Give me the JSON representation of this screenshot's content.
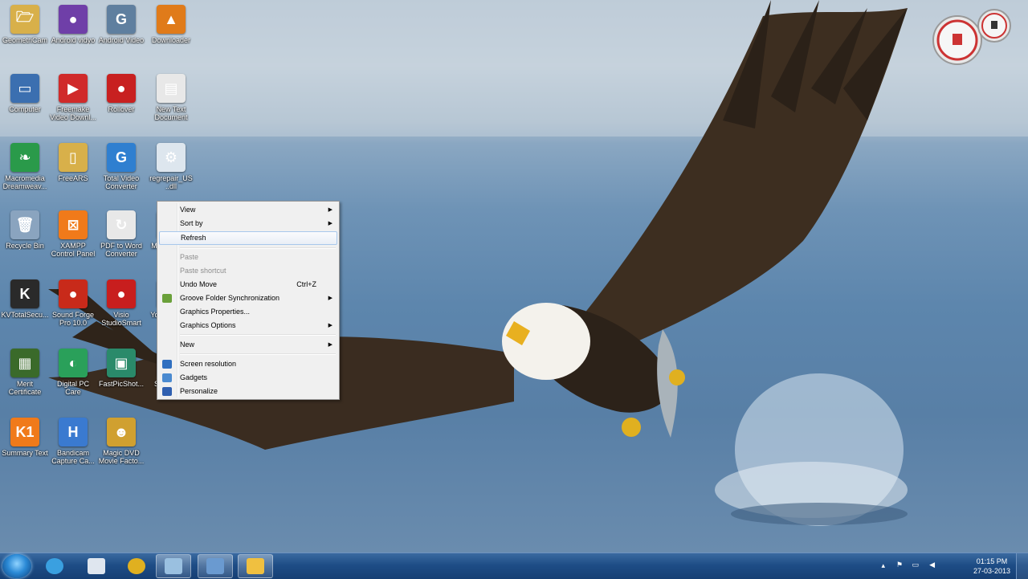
{
  "desktop": {
    "icons": [
      {
        "label": "GeometriCam",
        "color": "#d8b04a",
        "symbol": "🗁"
      },
      {
        "label": "Android vidyo",
        "color": "#6f3fa8",
        "symbol": "●"
      },
      {
        "label": "Android Video",
        "color": "#5f7f9f",
        "symbol": "G"
      },
      {
        "label": "Downloader",
        "color": "#e07b1a",
        "symbol": "▲"
      },
      {
        "label": "Computer",
        "color": "#3b6fb0",
        "symbol": "▭"
      },
      {
        "label": "Freemake Video Downl...",
        "color": "#d02a2a",
        "symbol": "▶"
      },
      {
        "label": "Rollover",
        "color": "#c82020",
        "symbol": "●"
      },
      {
        "label": "New Text Document",
        "color": "#e8e8e8",
        "symbol": "▤"
      },
      {
        "label": "Macromedia Dreamweav...",
        "color": "#2a9a4a",
        "symbol": "❧"
      },
      {
        "label": "FreeARS",
        "color": "#d8b04a",
        "symbol": "▯"
      },
      {
        "label": "Total Video Converter",
        "color": "#2f7fd0",
        "symbol": "G"
      },
      {
        "label": "regrepair_US ..dll",
        "color": "#dde6ee",
        "symbol": "⚙"
      },
      {
        "label": "Recycle Bin",
        "color": "#8aa4bf",
        "symbol": "🗑"
      },
      {
        "label": "XAMPP Control Panel",
        "color": "#f07a1a",
        "symbol": "⊠"
      },
      {
        "label": "PDF to Word Converter",
        "color": "#e8e8e8",
        "symbol": "↻"
      },
      {
        "label": "Macromedia Flash 8",
        "color": "#c81e1e",
        "symbol": "f"
      },
      {
        "label": "KVTotalSecu...",
        "color": "#2a2a2a",
        "symbol": "K"
      },
      {
        "label": "Sound Forge Pro 10.0",
        "color": "#c82a1a",
        "symbol": "●"
      },
      {
        "label": "Visio StudioSmart",
        "color": "#c81e1e",
        "symbol": "●"
      },
      {
        "label": "YouTube S...",
        "color": "#8a1a1a",
        "symbol": "◯"
      },
      {
        "label": "Merit Certificate",
        "color": "#3a6a2a",
        "symbol": "▦"
      },
      {
        "label": "Digital PC Care",
        "color": "#2aa05a",
        "symbol": "◐"
      },
      {
        "label": "FastPicShot...",
        "color": "#2a8a6a",
        "symbol": "▣"
      },
      {
        "label": "Skype.exe",
        "color": "#f0f0f0",
        "symbol": "▤"
      },
      {
        "label": "Summary Text",
        "color": "#f07a1a",
        "symbol": "K1"
      },
      {
        "label": "Bandicam Capture Ca...",
        "color": "#3a7ad0",
        "symbol": "H"
      },
      {
        "label": "Magic DVD Movie Facto...",
        "color": "#d0a030",
        "symbol": "☻"
      }
    ]
  },
  "context_menu": {
    "items": [
      {
        "label": "View",
        "has_submenu": true
      },
      {
        "label": "Sort by",
        "has_submenu": true
      },
      {
        "label": "Refresh",
        "highlighted": true
      },
      {
        "label": "Paste",
        "disabled": true
      },
      {
        "label": "Paste shortcut",
        "disabled": true
      },
      {
        "label": "Undo Move",
        "shortcut": "Ctrl+Z"
      },
      {
        "label": "Groove Folder Synchronization",
        "has_submenu": true,
        "icon_color": "#6aa03a"
      },
      {
        "label": "Graphics Properties..."
      },
      {
        "label": "Graphics Options",
        "has_submenu": true
      },
      {
        "label": "New",
        "has_submenu": true
      },
      {
        "label": "Screen resolution",
        "icon_color": "#2f6fc0"
      },
      {
        "label": "Gadgets",
        "icon_color": "#4a8ad0"
      },
      {
        "label": "Personalize",
        "icon_color": "#2f5fb0"
      }
    ]
  },
  "taskbar": {
    "clock_time": "01:15 PM",
    "clock_date": "27-03-2013",
    "pinned": [
      {
        "name": "media-player",
        "color": "#3aa0e0"
      },
      {
        "name": "connect",
        "color": "#dfe6ef"
      },
      {
        "name": "chrome",
        "color": "#e0b020"
      },
      {
        "name": "window",
        "color": "#9ac0e0",
        "active": true
      },
      {
        "name": "save",
        "color": "#6a9ad0",
        "active": true
      },
      {
        "name": "explorer",
        "color": "#f0c040",
        "active": true
      }
    ]
  },
  "colors": {
    "taskbar": "#1e4d86",
    "menu_bg": "#f0f0f0",
    "highlight_border": "#a8c8ec"
  }
}
